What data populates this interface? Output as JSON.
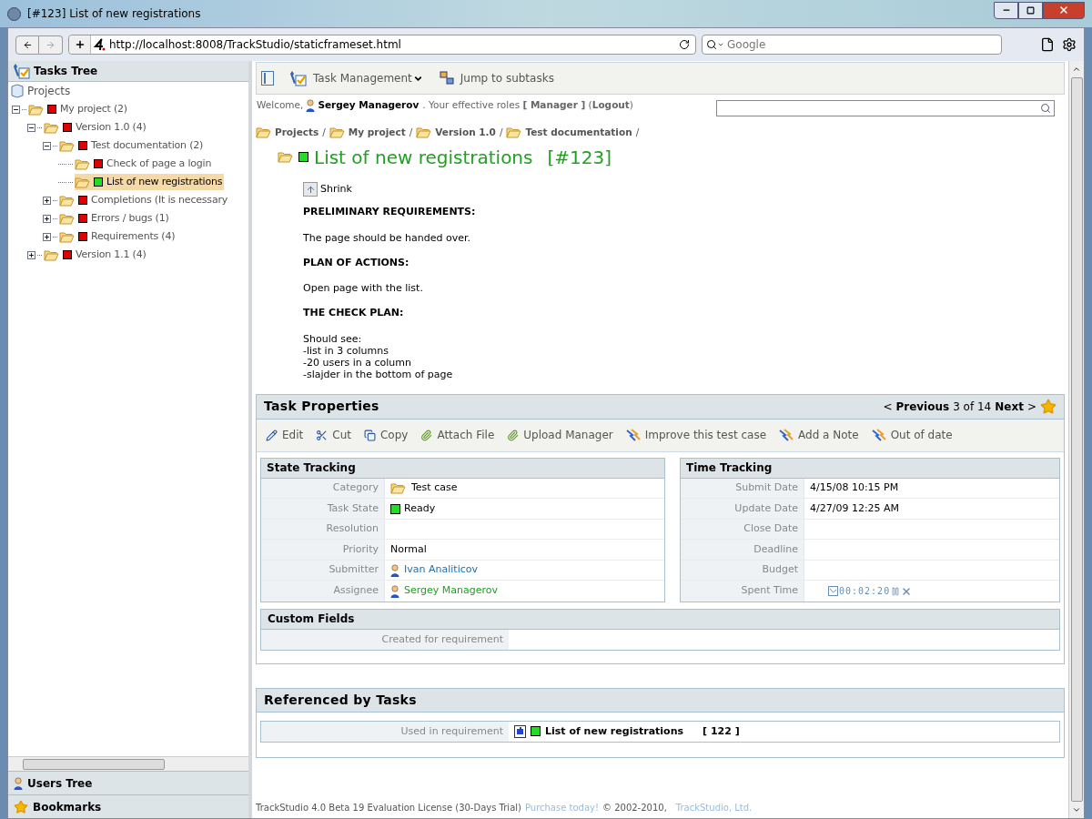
{
  "window": {
    "title": "[#123] List of new registrations"
  },
  "browser": {
    "url": "http://localhost:8008/TrackStudio/staticframeset.html",
    "search_placeholder": "Google"
  },
  "sidebar": {
    "title": "Tasks Tree",
    "root": "Projects",
    "tree": [
      {
        "label": "My project (2)",
        "color": "#e00000",
        "expanded": true,
        "selected": false,
        "children": [
          {
            "label": "Version 1.0 (4)",
            "color": "#e00000",
            "expanded": true,
            "selected": false,
            "children": [
              {
                "label": "Test documentation (2)",
                "color": "#e00000",
                "expanded": true,
                "selected": false,
                "children": [
                  {
                    "label": "Check of page a login",
                    "color": "#e00000",
                    "selected": false
                  },
                  {
                    "label": "List of new registrations",
                    "color": "#22dd22",
                    "selected": true
                  }
                ]
              },
              {
                "label": "Completions (It is necessary",
                "color": "#e00000",
                "expanded": false,
                "selected": false
              },
              {
                "label": "Errors / bugs (1)",
                "color": "#e00000",
                "expanded": false,
                "selected": false
              },
              {
                "label": "Requirements (4)",
                "color": "#e00000",
                "expanded": false,
                "selected": false
              }
            ]
          },
          {
            "label": "Version 1.1 (4)",
            "color": "#e00000",
            "expanded": false,
            "selected": false
          }
        ]
      }
    ],
    "bottom": [
      {
        "label": "Users Tree",
        "kind": "users"
      },
      {
        "label": "Bookmarks",
        "kind": "star"
      }
    ]
  },
  "toolbar": [
    {
      "label": "Task Management",
      "kind": "menu"
    },
    {
      "label": "Jump to subtasks",
      "kind": "jump"
    }
  ],
  "welcome": {
    "greeting": "Welcome,",
    "user": "Sergey Managerov",
    "roles": ". Your effective roles **[ Manager ]** (**Logout**)"
  },
  "breadcrumbs": {
    "separator": "/",
    "items": [
      "Projects",
      "My project",
      "Version 1.0",
      "Test documentation"
    ]
  },
  "task": {
    "title": "List of new registrations",
    "number": "[#123]",
    "color": "#22dd22"
  },
  "shrink": "Shrink",
  "description": [
    {
      "heading": "PRELIMINARY REQUIREMENTS:",
      "lines": [
        "The page should be handed over."
      ]
    },
    {
      "heading": "PLAN OF ACTIONS:",
      "lines": [
        "Open page with the list."
      ]
    },
    {
      "heading": "THE CHECK PLAN:",
      "lines": [
        "Should see:",
        "-list in 3 columns",
        "-20 users in a column",
        "-slajder in the bottom of page"
      ]
    }
  ],
  "properties": {
    "title": "Task Properties",
    "nav": {
      "prev_arrow": "<",
      "previous": "Previous",
      "position": "3 of 14",
      "next": "Next",
      "next_arrow": ">"
    },
    "actions": [
      {
        "label": "Edit",
        "kind": "edit"
      },
      {
        "label": "Cut",
        "kind": "cut"
      },
      {
        "label": "Copy",
        "kind": "copy"
      },
      {
        "label": "Attach File",
        "kind": "attach"
      },
      {
        "label": "Upload Manager",
        "kind": "attach"
      },
      {
        "label": "Improve this test case",
        "kind": "state"
      },
      {
        "label": "Add a Note",
        "kind": "state"
      },
      {
        "label": "Out of date",
        "kind": "state"
      }
    ],
    "state_tracking": {
      "title": "State Tracking",
      "rows": [
        {
          "label": "Category",
          "value": "Test case",
          "kind": "folder"
        },
        {
          "label": "Task State",
          "value": "Ready",
          "kind": "state",
          "color": "#22dd22"
        },
        {
          "label": "Resolution",
          "kind": "empty"
        },
        {
          "label": "Priority",
          "value": "Normal",
          "kind": "text"
        },
        {
          "label": "Submitter",
          "value": "Ivan Analiticov",
          "kind": "user",
          "color": "#1a6fb0"
        },
        {
          "label": "Assignee",
          "value": "Sergey Managerov",
          "kind": "user",
          "color": "#22a022"
        }
      ]
    },
    "time_tracking": {
      "title": "Time Tracking",
      "rows": [
        {
          "label": "Submit Date",
          "value": "4/15/08 10:15 PM",
          "kind": "text"
        },
        {
          "label": "Update Date",
          "value": "4/27/09 12:25 AM",
          "kind": "text"
        },
        {
          "label": "Close Date",
          "kind": "empty"
        },
        {
          "label": "Deadline",
          "kind": "empty"
        },
        {
          "label": "Budget",
          "kind": "empty"
        },
        {
          "label": "Spent Time",
          "value": "00:02:20",
          "kind": "timer"
        }
      ]
    },
    "custom_fields": {
      "title": "Custom Fields",
      "rows": [
        {
          "label": "Created for requirement"
        }
      ]
    }
  },
  "referenced": {
    "title": "Referenced by Tasks",
    "rows": [
      {
        "label": "Used in requirement",
        "task": "List of new registrations",
        "number": "[ 122 ]",
        "color": "#22dd22"
      }
    ]
  },
  "footer": {
    "text": "TrackStudio 4.0 Beta 19 Evaluation License (30-Days Trial)",
    "link": "Purchase today!",
    "copyright": "© 2002-2010,",
    "company": "TrackStudio, Ltd."
  }
}
